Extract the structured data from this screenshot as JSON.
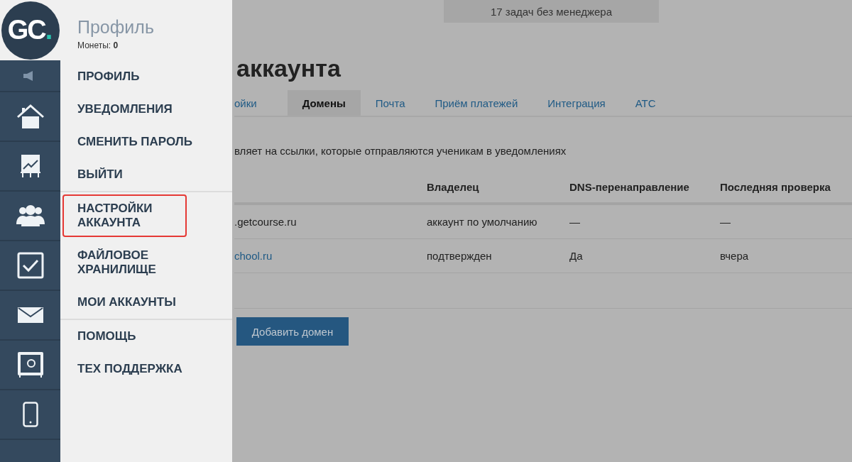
{
  "logo": {
    "text": "GC",
    "dot": "."
  },
  "sidebar": {
    "items": [
      {
        "kind": "speaker"
      },
      {
        "kind": "home"
      },
      {
        "kind": "chart"
      },
      {
        "kind": "people"
      },
      {
        "kind": "check"
      },
      {
        "kind": "mail"
      },
      {
        "kind": "safe"
      },
      {
        "kind": "phone"
      }
    ]
  },
  "menu": {
    "title": "Профиль",
    "coins_label": "Монеты:",
    "coins": "0",
    "groups": [
      [
        {
          "label": "ПРОФИЛЬ",
          "outlined": false
        },
        {
          "label": "УВЕДОМЛЕНИЯ",
          "outlined": false
        },
        {
          "label": "СМЕНИТЬ ПАРОЛЬ",
          "outlined": false
        },
        {
          "label": "ВЫЙТИ",
          "outlined": false
        }
      ],
      [
        {
          "label": "НАСТРОЙКИ АККАУНТА",
          "outlined": true
        },
        {
          "label": "ФАЙЛОВОЕ ХРАНИЛИЩЕ",
          "outlined": false
        },
        {
          "label": "МОИ АККАУНТЫ",
          "outlined": false
        }
      ],
      [
        {
          "label": "ПОМОЩЬ",
          "outlined": false
        },
        {
          "label": "ТЕХ ПОДДЕРЖКА",
          "outlined": false
        }
      ]
    ]
  },
  "banner": "17 задач без менеджера",
  "page_title": "аккаунта",
  "tabs": [
    {
      "label": "ойки",
      "selected": false
    },
    {
      "label": "Домены",
      "selected": true
    },
    {
      "label": "Почта",
      "selected": false
    },
    {
      "label": "Приём платежей",
      "selected": false
    },
    {
      "label": "Интеграция",
      "selected": false
    },
    {
      "label": "АТС",
      "selected": false
    }
  ],
  "description": "вляет на ссылки, которые отправляются ученикам в уведомлениях",
  "table": {
    "columns": [
      "",
      "Владелец",
      "DNS-перенаправление",
      "Последняя проверка"
    ],
    "rows": [
      {
        "domain": ".getcourse.ru",
        "link": false,
        "owner": "аккаунт по умолчанию",
        "dns": "—",
        "checked": "—"
      },
      {
        "domain": "chool.ru",
        "link": true,
        "owner": "подтвержден",
        "dns": "Да",
        "checked": "вчера"
      }
    ]
  },
  "add_button": "Добавить домен"
}
